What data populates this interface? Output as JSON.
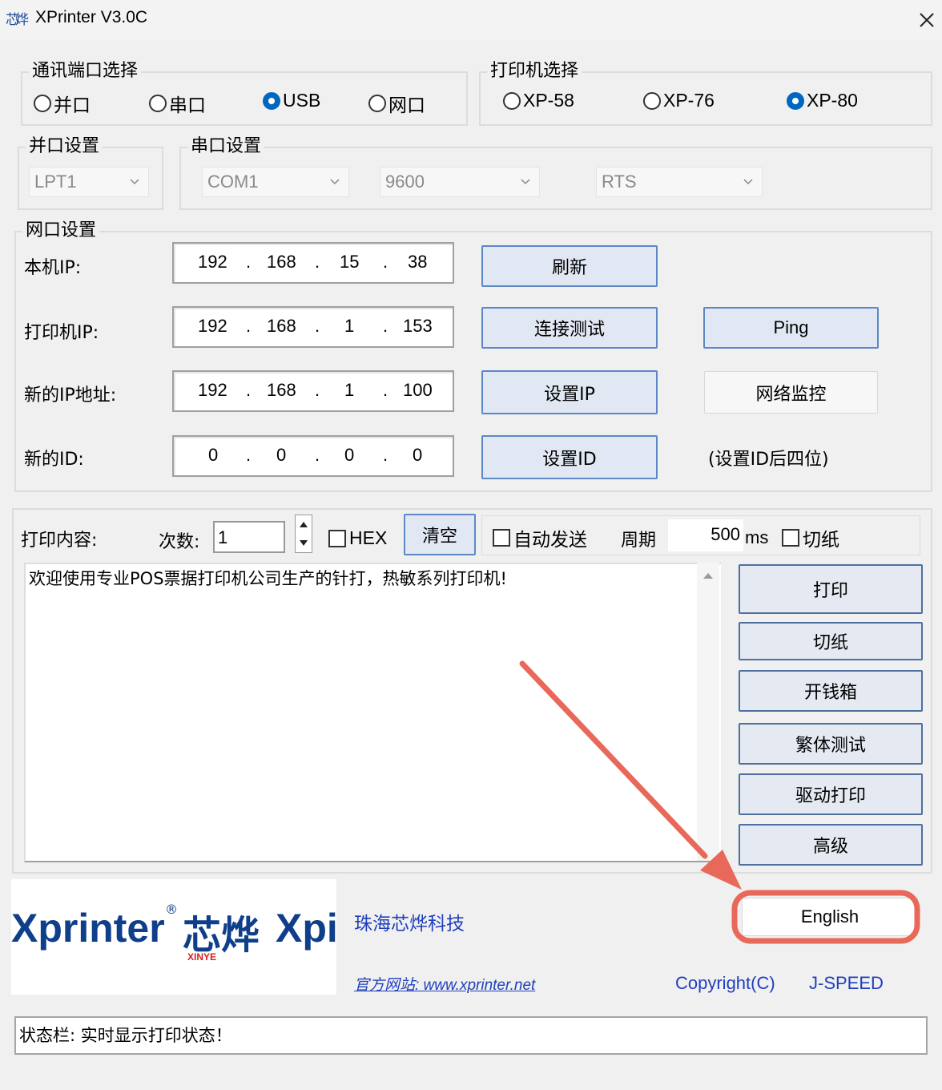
{
  "window": {
    "title": "XPrinter V3.0C",
    "close_glyph": "✕"
  },
  "comm": {
    "label": "通讯端口选择",
    "options": [
      "并口",
      "串口",
      "USB",
      "网口"
    ],
    "selected": "USB"
  },
  "printer": {
    "label": "打印机选择",
    "options": [
      "XP-58",
      "XP-76",
      "XP-80"
    ],
    "selected": "XP-80"
  },
  "parallel": {
    "label": "并口设置",
    "port": "LPT1"
  },
  "serial": {
    "label": "串口设置",
    "port": "COM1",
    "baud": "9600",
    "flow": "RTS"
  },
  "network": {
    "label": "网口设置",
    "rows": [
      {
        "label": "本机IP:",
        "ip": [
          "192",
          "168",
          "15",
          "38"
        ]
      },
      {
        "label": "打印机IP:",
        "ip": [
          "192",
          "168",
          "1",
          "153"
        ]
      },
      {
        "label": "新的IP地址:",
        "ip": [
          "192",
          "168",
          "1",
          "100"
        ]
      },
      {
        "label": "新的ID:",
        "ip": [
          "0",
          "0",
          "0",
          "0"
        ]
      }
    ],
    "refresh": "刷新",
    "connect_test": "连接测试",
    "ping": "Ping",
    "set_ip": "设置IP",
    "net_monitor": "网络监控",
    "set_id": "设置ID",
    "id_hint": "(设置ID后四位)"
  },
  "print": {
    "content_label": "打印内容:",
    "count_label": "次数:",
    "count_value": "1",
    "hex_label": "HEX",
    "clear": "清空",
    "auto_send": "自动发送",
    "period_label": "周期",
    "period_value": "500",
    "period_unit": "ms",
    "cut_paper": "切纸",
    "text": "欢迎使用专业POS票据打印机公司生产的针打，热敏系列打印机!"
  },
  "side_buttons": [
    "打印",
    "切纸",
    "开钱箱",
    "繁体测试",
    "驱动打印",
    "高级"
  ],
  "footer": {
    "logo_text": "Xprinter",
    "logo_cn": "芯烨",
    "logo_text2": "Xpi",
    "logo_sub": "XINYE",
    "logo_reg": "®",
    "company": "珠海芯烨科技",
    "website": "官方网站: www.xprinter.net",
    "english_button": "English",
    "copyright": "Copyright(C)",
    "jspeed": "J-SPEED"
  },
  "status": {
    "text": "状态栏: 实时显示打印状态！"
  },
  "colors": {
    "accent": "#0067c0",
    "highlight_ring": "#e8685a",
    "link": "#1f3fbd",
    "logo_blue": "#0f3e8a",
    "logo_red": "#d81e1e"
  }
}
